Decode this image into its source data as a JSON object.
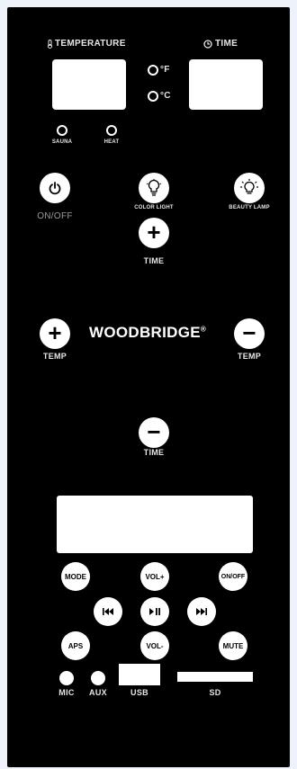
{
  "header": {
    "temperature_label": "TEMPERATURE",
    "time_label": "TIME",
    "fahrenheit_label": "°F",
    "celsius_label": "°C",
    "sauna_label": "SAUNA",
    "heat_label": "HEAT"
  },
  "controls": {
    "on_off_label": "ON/OFF",
    "color_light_label": "COLOR LIGHT",
    "beauty_lamp_label": "BEAUTY LAMP",
    "time_up_symbol": "+",
    "time_up_label": "TIME",
    "temp_up_symbol": "+",
    "temp_up_label": "TEMP",
    "temp_down_symbol": "−",
    "temp_down_label": "TEMP",
    "time_down_symbol": "−",
    "time_down_label": "TIME",
    "brand": "WOODBRIDGE",
    "brand_mark": "®"
  },
  "media": {
    "mode_label": "MODE",
    "vol_up_label": "VOL+",
    "onoff_label": "ON/OFF",
    "prev_symbol": "⏮",
    "play_pause_symbol": "▶❚❚",
    "next_symbol": "⏭",
    "aps_label": "APS",
    "vol_down_label": "VOL-",
    "mute_label": "MUTE"
  },
  "ports": {
    "mic_label": "MIC",
    "aux_label": "AUX",
    "usb_label": "USB",
    "sd_label": "SD"
  }
}
